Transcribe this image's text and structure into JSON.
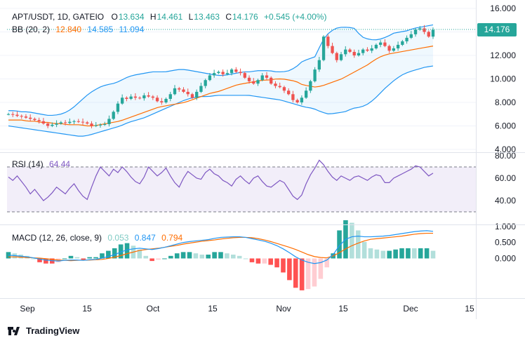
{
  "header": {
    "symbol": "APT/USDT, 1D, GATEIO",
    "open_label": "O",
    "open": "13.634",
    "high_label": "H",
    "high": "14.461",
    "low_label": "L",
    "low": "13.463",
    "close_label": "C",
    "close": "14.176",
    "change": "+0.545 (+4.00%)",
    "bb_label": "BB (20, 2)",
    "bb_basis": "12.840",
    "bb_upper": "14.585",
    "bb_lower": "11.094",
    "rsi_label": "RSI (14)",
    "rsi_value": "64.44",
    "macd_label": "MACD (12, 26, close, 9)",
    "macd_hist": "0.053",
    "macd_line": "0.847",
    "macd_signal": "0.794"
  },
  "price_badge": "14.176",
  "brand": "TradingView",
  "colors": {
    "up": "#26a69a",
    "down": "#ef5350",
    "basis": "#ff6d00",
    "band": "#2196f3",
    "rsi": "#7e57c2",
    "macd": "#2196f3",
    "signal": "#ff6d00",
    "hist_up_strong": "#26a69a",
    "hist_up_weak": "#b2dfdb",
    "hist_down_strong": "#ff5252",
    "hist_down_weak": "#ffcdd2"
  },
  "chart_data": {
    "type": "candlestick",
    "x_ticks": [
      "Sep",
      "15",
      "Oct",
      "15",
      "Nov",
      "15",
      "Dec",
      "15"
    ],
    "price_axis": {
      "ticks": [
        "16.000",
        "14.000",
        "12.000",
        "10.000",
        "8.000",
        "6.000",
        "4.000"
      ],
      "ylim": [
        4,
        16
      ]
    },
    "rsi_axis": {
      "ticks": [
        "80.00",
        "60.00",
        "40.00"
      ],
      "ylim": [
        20,
        80
      ],
      "band": [
        30,
        70
      ]
    },
    "macd_axis": {
      "ticks": [
        "1.000",
        "0.500",
        "0.000"
      ],
      "ylim": [
        -1.2,
        1.0
      ]
    },
    "closes": [
      7.0,
      6.95,
      6.85,
      6.8,
      6.7,
      6.6,
      6.5,
      6.4,
      6.2,
      6.0,
      6.1,
      6.2,
      6.3,
      6.25,
      6.35,
      6.4,
      6.35,
      6.3,
      6.2,
      6.0,
      6.05,
      6.1,
      6.15,
      6.6,
      7.2,
      7.9,
      8.4,
      8.3,
      8.5,
      8.4,
      8.35,
      8.6,
      8.5,
      8.4,
      8.1,
      8.0,
      8.3,
      8.7,
      9.2,
      9.1,
      8.9,
      8.7,
      8.4,
      8.9,
      9.4,
      9.9,
      10.3,
      10.5,
      10.6,
      10.4,
      10.5,
      10.8,
      10.6,
      10.5,
      10.1,
      9.8,
      9.6,
      9.9,
      10.3,
      10.1,
      9.6,
      9.4,
      9.3,
      9.0,
      8.7,
      8.2,
      8.0,
      8.4,
      9.0,
      9.8,
      10.8,
      11.6,
      13.6,
      12.8,
      12.2,
      11.6,
      12.1,
      12.5,
      12.3,
      12.0,
      12.2,
      12.5,
      12.4,
      12.6,
      12.9,
      13.1,
      12.8,
      12.4,
      12.6,
      12.9,
      13.2,
      13.5,
      13.8,
      14.2,
      14.3,
      14.0,
      13.6,
      14.18
    ],
    "bb_basis": [
      6.5,
      6.5,
      6.5,
      6.4,
      6.4,
      6.3,
      6.3,
      6.2,
      6.2,
      6.1,
      6.1,
      6.1,
      6.0,
      6.0,
      6.1,
      6.2,
      6.3,
      6.4,
      6.6,
      6.8,
      7.0,
      7.2,
      7.4,
      7.6,
      7.7,
      7.8,
      7.9,
      8.0,
      8.2,
      8.4,
      8.6,
      8.8,
      8.9,
      9.1,
      9.3,
      9.5,
      9.6,
      9.7,
      9.8,
      9.9,
      9.9,
      10.0,
      10.0,
      9.9,
      9.8,
      9.5,
      9.4,
      9.3,
      9.4,
      9.6,
      9.8,
      10.0,
      10.3,
      10.6,
      10.9,
      11.2,
      11.6,
      11.9,
      12.1,
      12.2,
      12.3,
      12.4,
      12.5,
      12.6,
      12.7,
      12.8
    ],
    "bb_upper": [
      7.3,
      7.3,
      7.2,
      7.2,
      7.1,
      7.0,
      6.9,
      6.9,
      7.0,
      7.2,
      7.6,
      8.1,
      8.6,
      9.0,
      9.3,
      9.5,
      9.6,
      9.8,
      10.1,
      10.3,
      10.4,
      10.5,
      10.6,
      10.6,
      10.6,
      10.7,
      10.8,
      10.8,
      10.7,
      10.6,
      10.5,
      10.4,
      10.3,
      10.3,
      10.4,
      10.5,
      10.6,
      10.6,
      10.7,
      10.7,
      10.7,
      10.6,
      10.6,
      10.7,
      11.0,
      11.5,
      11.7,
      11.9,
      13.2,
      13.9,
      14.3,
      14.4,
      14.4,
      14.3,
      13.6,
      13.4,
      13.3,
      13.4,
      13.6,
      13.9,
      14.0,
      14.1,
      14.3,
      14.4,
      14.5,
      14.6
    ],
    "bb_lower": [
      6.0,
      5.9,
      5.8,
      5.7,
      5.6,
      5.5,
      5.4,
      5.3,
      5.2,
      5.1,
      5.2,
      5.4,
      5.6,
      5.8,
      6.0,
      6.3,
      6.5,
      6.7,
      7.0,
      7.3,
      7.6,
      7.9,
      8.2,
      8.4,
      8.5,
      8.5,
      8.6,
      8.6,
      8.6,
      8.6,
      8.6,
      8.5,
      8.4,
      8.3,
      8.2,
      8.0,
      7.8,
      7.6,
      7.5,
      7.2,
      7.0,
      7.1,
      7.2,
      7.5,
      7.6,
      7.9,
      8.5,
      9.2,
      9.8,
      10.3,
      10.6,
      10.8,
      11.0,
      11.1
    ],
    "rsi": [
      61,
      58,
      62,
      57,
      52,
      46,
      50,
      45,
      40,
      43,
      47,
      52,
      49,
      46,
      51,
      55,
      49,
      44,
      41,
      52,
      62,
      70,
      66,
      62,
      68,
      65,
      70,
      66,
      61,
      57,
      55,
      61,
      70,
      66,
      62,
      65,
      69,
      62,
      56,
      52,
      60,
      66,
      63,
      60,
      59,
      65,
      68,
      64,
      62,
      58,
      56,
      53,
      59,
      62,
      58,
      55,
      60,
      62,
      57,
      53,
      52,
      55,
      58,
      56,
      50,
      44,
      41,
      45,
      55,
      63,
      69,
      76,
      72,
      66,
      61,
      58,
      62,
      60,
      58,
      61,
      62,
      60,
      58,
      61,
      63,
      62,
      56,
      56,
      60,
      62,
      64,
      66,
      68,
      71,
      70,
      66,
      62,
      64.44
    ],
    "macd": [
      0.1,
      0.09,
      0.07,
      0.05,
      0.02,
      -0.02,
      -0.05,
      -0.07,
      -0.08,
      -0.06,
      -0.05,
      -0.05,
      -0.06,
      -0.04,
      -0.03,
      0.01,
      0.06,
      0.12,
      0.2,
      0.27,
      0.3,
      0.32,
      0.3,
      0.28,
      0.31,
      0.35,
      0.4,
      0.45,
      0.5,
      0.53,
      0.55,
      0.57,
      0.59,
      0.63,
      0.66,
      0.67,
      0.68,
      0.68,
      0.66,
      0.62,
      0.58,
      0.54,
      0.48,
      0.4,
      0.3,
      0.18,
      0.05,
      -0.05,
      -0.12,
      -0.16,
      -0.13,
      -0.05,
      0.12,
      0.4,
      0.6,
      0.68,
      0.7,
      0.68,
      0.68,
      0.69,
      0.7,
      0.72,
      0.75,
      0.78,
      0.81,
      0.84,
      0.86,
      0.87,
      0.85
    ],
    "macd_signal": [
      0.05,
      0.05,
      0.04,
      0.03,
      0.02,
      0.01,
      -0.01,
      -0.03,
      -0.05,
      -0.06,
      -0.07,
      -0.06,
      -0.05,
      -0.05,
      -0.04,
      -0.03,
      0.0,
      0.04,
      0.09,
      0.15,
      0.2,
      0.25,
      0.28,
      0.3,
      0.32,
      0.35,
      0.38,
      0.41,
      0.45,
      0.48,
      0.51,
      0.54,
      0.56,
      0.58,
      0.61,
      0.63,
      0.65,
      0.66,
      0.66,
      0.65,
      0.62,
      0.58,
      0.53,
      0.47,
      0.41,
      0.35,
      0.28,
      0.2,
      0.12,
      0.06,
      0.03,
      0.02,
      0.08,
      0.18,
      0.3,
      0.4,
      0.48,
      0.55,
      0.6,
      0.62,
      0.64,
      0.66,
      0.68,
      0.7,
      0.73,
      0.76,
      0.78,
      0.79,
      0.79
    ]
  }
}
